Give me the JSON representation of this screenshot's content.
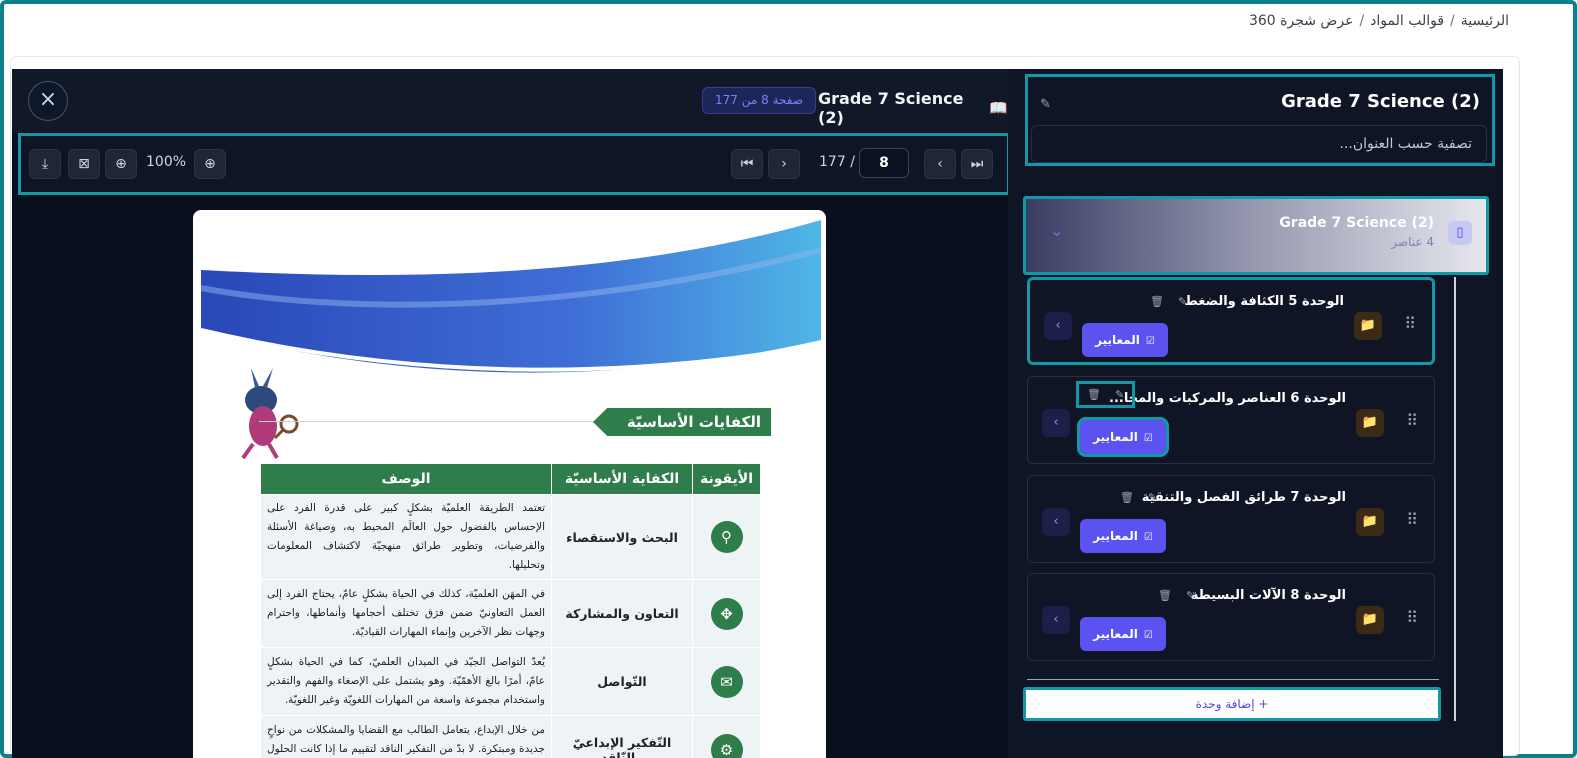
{
  "breadcrumb": {
    "home": "الرئيسية",
    "sep": "/",
    "templates": "قوالب المواد",
    "current": "عرض شجرة 360"
  },
  "viewer": {
    "title": "Grade 7 Science (2)",
    "book_icon": "book-icon",
    "page_badge": "صفحة 8 من 177",
    "close_icon": "×",
    "toolbar": {
      "zoom_label": "100%",
      "page_value": "8",
      "page_total": "177",
      "page_sep": "/"
    }
  },
  "pdf": {
    "heading": "الكفايات الأساسيّة",
    "columns": [
      "الأيقونة",
      "الكفاية الأساسيّة",
      "الوصف"
    ],
    "rows": [
      {
        "name": "البحث والاستقصاء",
        "desc": "تعتمد الطريقة العلميّة بشكلٍ كبير على قدرة الفرد على الإحساس بالفضول حول العالَم المحيط به، وصياغة الأسئلة والفرضيات، وتطوير طرائق منهجيّة لاكتشاف المعلومات وتحليلها."
      },
      {
        "name": "التعاون والمشاركة",
        "desc": "في المهَن العلميّة، كذلك في الحياة بشكلٍ عامّ، يحتاج الفرد إلى العمل التعاونيّ ضمن فرَق تختلف أحجامها وأنماطها، واحترام وجهات نظر الآخرين وإنماء المهارات القياديّة."
      },
      {
        "name": "التّواصل",
        "desc": "يُعدّ التواصل الجيّد في الميدان العلميّ، كما في الحياة بشكلٍ عامّ، أمرًا بالغ الأهمّيّة. وهو يشتمل على الإصغاء والفهم والتقدير واستخدام مجموعة واسعة من المهارات اللغويّة وغير اللغويّة."
      },
      {
        "name": "التّفكير الإبداعيّ والنّاقد",
        "desc": "من خلال الإبداع، يتعامل الطالب مع القضايا والمشكلات من نواحٍ جديدة ومبتكرة. لا بدّ من التفكير الناقد لتقييم ما إذا كانت الحلول والأفكار المطروحة"
      }
    ]
  },
  "tree": {
    "title": "Grade 7 Science (2)",
    "filter_placeholder": "تصفية حسب العنوان...",
    "group": {
      "title": "Grade 7 Science (2)",
      "count": "4 عناصر"
    },
    "units": [
      {
        "title": "الوحدة 5 الكثافة والضغط",
        "criteria": "المعايير"
      },
      {
        "title": "الوحدة 6 العناصر والمركبات والمخا...",
        "criteria": "المعايير"
      },
      {
        "title": "الوحدة 7 طرائق الفصل والتنقية",
        "criteria": "المعايير"
      },
      {
        "title": "الوحدة 8 الآلات البسيطة",
        "criteria": "المعايير"
      }
    ],
    "add_unit": "+ إضافة وحدة"
  },
  "colors": {
    "accent": "#5b52f0",
    "highlight": "#1299a8",
    "panel": "#0f1525",
    "pdf_green": "#2e7d4a"
  }
}
